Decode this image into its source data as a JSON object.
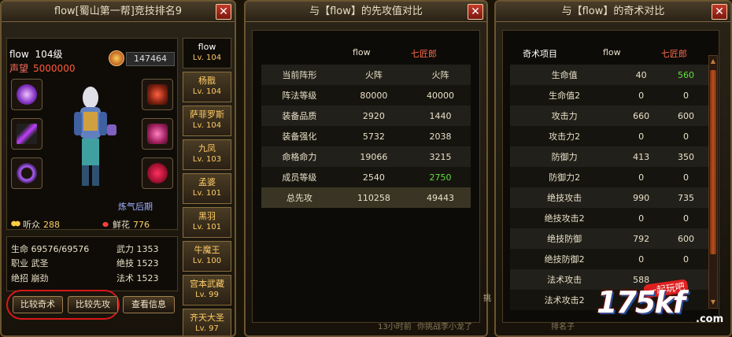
{
  "panel1": {
    "title": "flow[蜀山第一帮]竞技排名9",
    "close": "✕",
    "name": "flow",
    "level": "104级",
    "reputation_label": "声望",
    "reputation_value": "5000000",
    "power": "147464",
    "realm": "炼气后期",
    "listeners_label": "听众",
    "listeners_value": "288",
    "flowers_label": "鲜花",
    "flowers_value": "776",
    "stats": {
      "hp_label": "生命",
      "hp_value": "69576/69576",
      "wuli_label": "武力",
      "wuli_value": "1353",
      "job_label": "职业",
      "job_value": "武圣",
      "juji_label": "绝技",
      "juji_value": "1523",
      "zhao_label": "绝招",
      "zhao_value": "崩劲",
      "fashu_label": "法术",
      "fashu_value": "1523"
    },
    "buttons": {
      "compare_qishu": "比较奇术",
      "compare_xiangong": "比较先攻",
      "view_info": "查看信息"
    },
    "partners": [
      {
        "name": "flow",
        "level": "Lv. 104"
      },
      {
        "name": "杨戬",
        "level": "Lv. 104"
      },
      {
        "name": "萨菲罗斯",
        "level": "Lv. 104"
      },
      {
        "name": "九凤",
        "level": "Lv. 103"
      },
      {
        "name": "孟婆",
        "level": "Lv. 101"
      },
      {
        "name": "黑羽",
        "level": "Lv. 101"
      },
      {
        "name": "牛魔王",
        "level": "Lv. 100"
      },
      {
        "name": "宫本武藏",
        "level": "Lv. 99"
      },
      {
        "name": "齐天大圣",
        "level": "Lv. 97"
      }
    ],
    "equip_icons": [
      "purple-orb-icon",
      "dagger-icon",
      "ring-icon",
      "red-armor-icon",
      "winged-armor-icon",
      "red-flower-icon"
    ]
  },
  "panel2": {
    "title": "与【flow】的先攻值对比",
    "close": "✕",
    "col_a": "flow",
    "col_b": "七匠郎",
    "rows": [
      {
        "label": "当前阵形",
        "a": "火阵",
        "b": "火阵"
      },
      {
        "label": "阵法等级",
        "a": "80000",
        "b": "40000"
      },
      {
        "label": "装备品质",
        "a": "2920",
        "b": "1440"
      },
      {
        "label": "装备强化",
        "a": "5732",
        "b": "2038"
      },
      {
        "label": "命格命力",
        "a": "19066",
        "b": "3215"
      },
      {
        "label": "成员等级",
        "a": "2540",
        "b": "2750"
      },
      {
        "label": "总先攻",
        "a": "110258",
        "b": "49443"
      }
    ]
  },
  "panel3": {
    "title": "与【flow】的奇术对比",
    "close": "✕",
    "col_item": "奇术项目",
    "col_a": "flow",
    "col_b": "七匠郎",
    "rows": [
      {
        "label": "生命值",
        "a": "40",
        "b": "560"
      },
      {
        "label": "生命值2",
        "a": "0",
        "b": "0"
      },
      {
        "label": "攻击力",
        "a": "660",
        "b": "600"
      },
      {
        "label": "攻击力2",
        "a": "0",
        "b": "0"
      },
      {
        "label": "防御力",
        "a": "413",
        "b": "350"
      },
      {
        "label": "防御力2",
        "a": "0",
        "b": "0"
      },
      {
        "label": "绝技攻击",
        "a": "990",
        "b": "735"
      },
      {
        "label": "绝技攻击2",
        "a": "0",
        "b": "0"
      },
      {
        "label": "绝技防御",
        "a": "792",
        "b": "600"
      },
      {
        "label": "绝技防御2",
        "a": "0",
        "b": "0"
      },
      {
        "label": "法术攻击",
        "a": "588",
        "b": ""
      },
      {
        "label": "法术攻击2",
        "a": "",
        "b": ""
      }
    ]
  },
  "background_text": {
    "chat1": "13小时前",
    "chat2": "你挑战李小龙了",
    "chat3": "排名子",
    "side": "挑"
  },
  "watermark": {
    "main": "175kf",
    "sub": "一起玩吧",
    "tld": ".com"
  },
  "colors": {
    "highlight_green": "#60e040",
    "name_red": "#ff6a4a",
    "gold": "#ffcc66"
  }
}
